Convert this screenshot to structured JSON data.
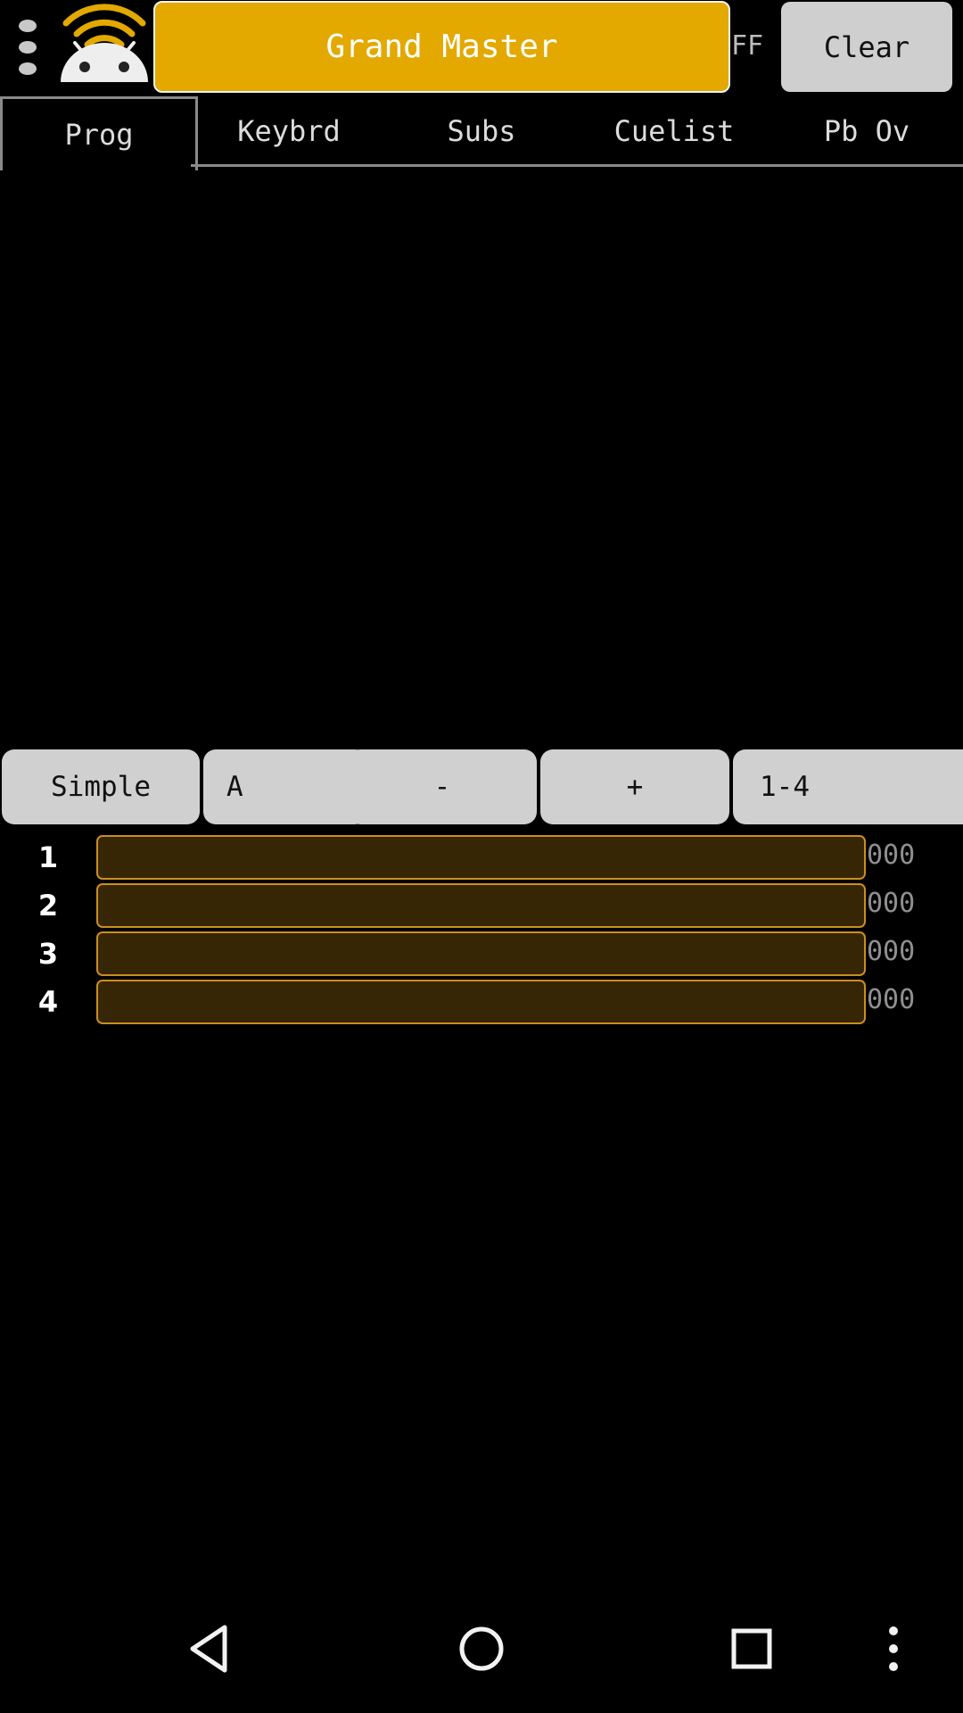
{
  "header": {
    "grand_master_label": "Grand Master",
    "ff_label": "FF",
    "clear_label": "Clear",
    "accent_color": "#e3a900"
  },
  "tabs": [
    {
      "label": "Prog",
      "selected": true
    },
    {
      "label": "Keybrd",
      "selected": false
    },
    {
      "label": "Subs",
      "selected": false
    },
    {
      "label": "Cuelist",
      "selected": false
    },
    {
      "label": "Pb Ov",
      "selected": false
    }
  ],
  "controls": {
    "mode_label": "Simple",
    "bank_label": "A",
    "minus_label": "-",
    "plus_label": "+",
    "range_label": "1-4"
  },
  "faders": [
    {
      "number": "1",
      "value_text": "000",
      "level": 0
    },
    {
      "number": "2",
      "value_text": "000",
      "level": 0
    },
    {
      "number": "3",
      "value_text": "000",
      "level": 0
    },
    {
      "number": "4",
      "value_text": "000",
      "level": 0
    }
  ],
  "icons": {
    "menu": "overflow-menu-icon",
    "logo": "wifi-android-logo",
    "back": "back-icon",
    "home": "home-icon",
    "recents": "recents-icon",
    "more": "more-vert-icon"
  }
}
